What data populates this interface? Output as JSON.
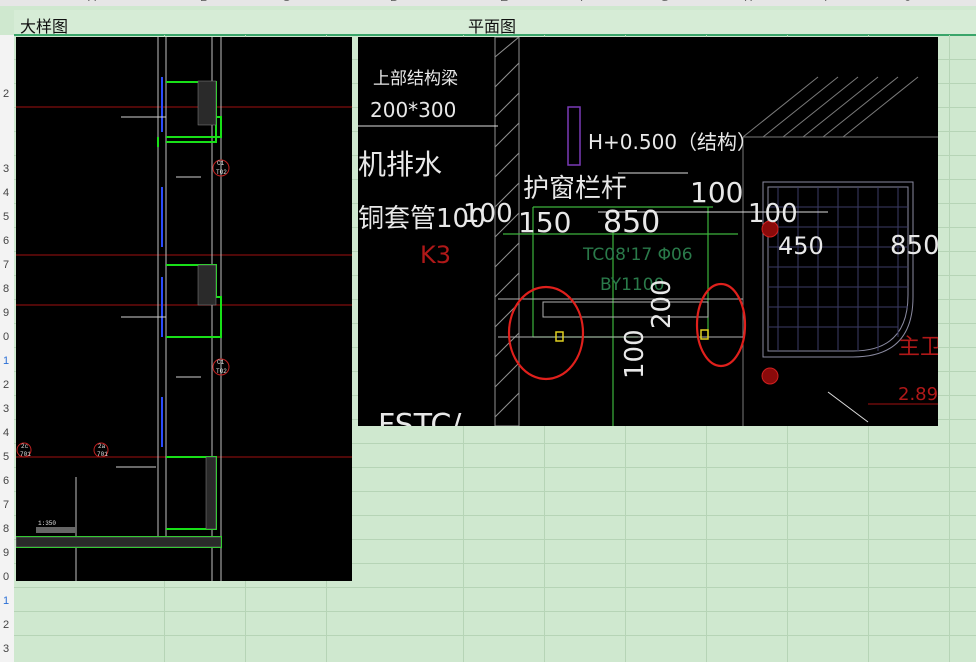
{
  "sheet": {
    "column_letters": [
      "A",
      "B",
      "C",
      "D",
      "E",
      "F",
      "G",
      "H",
      "I",
      "J"
    ],
    "row_numbers": [
      "2",
      "3",
      "4",
      "5",
      "6",
      "7",
      "8",
      "9",
      "0",
      "1",
      "2",
      "3",
      "4",
      "5",
      "6",
      "7",
      "8",
      "9",
      "0",
      "1",
      "2",
      "3"
    ],
    "selected_row_index": 9,
    "cells": {
      "left_label": "大样图",
      "right_label": "平面图"
    }
  },
  "detail_drawing": {
    "tags": [
      "C1",
      "TO2",
      "C1",
      "TO2",
      "2a",
      "701",
      "2c",
      "701"
    ],
    "notes": [
      "1:350"
    ]
  },
  "plan_drawing": {
    "texts": {
      "beam_label": "上部结构梁",
      "beam_size": "200*300",
      "drain": "机排水",
      "sleeve": "铜套管100",
      "k3": "K3",
      "railing": "护窗栏杆",
      "level": "H+0.500（结构）",
      "dim_100a": "100",
      "dim_150": "150",
      "dim_850a": "850",
      "dim_100b": "100",
      "dim_100c": "100",
      "dim_450": "450",
      "dim_850b": "850",
      "window_code": "TC08'17 Φ06",
      "by": "BY1100",
      "dim_200": "200",
      "dim_100d": "100",
      "room": "主卫",
      "elev": "2.89",
      "bottom_left": "FSTC/"
    },
    "highlight_color": "#e0201c"
  }
}
